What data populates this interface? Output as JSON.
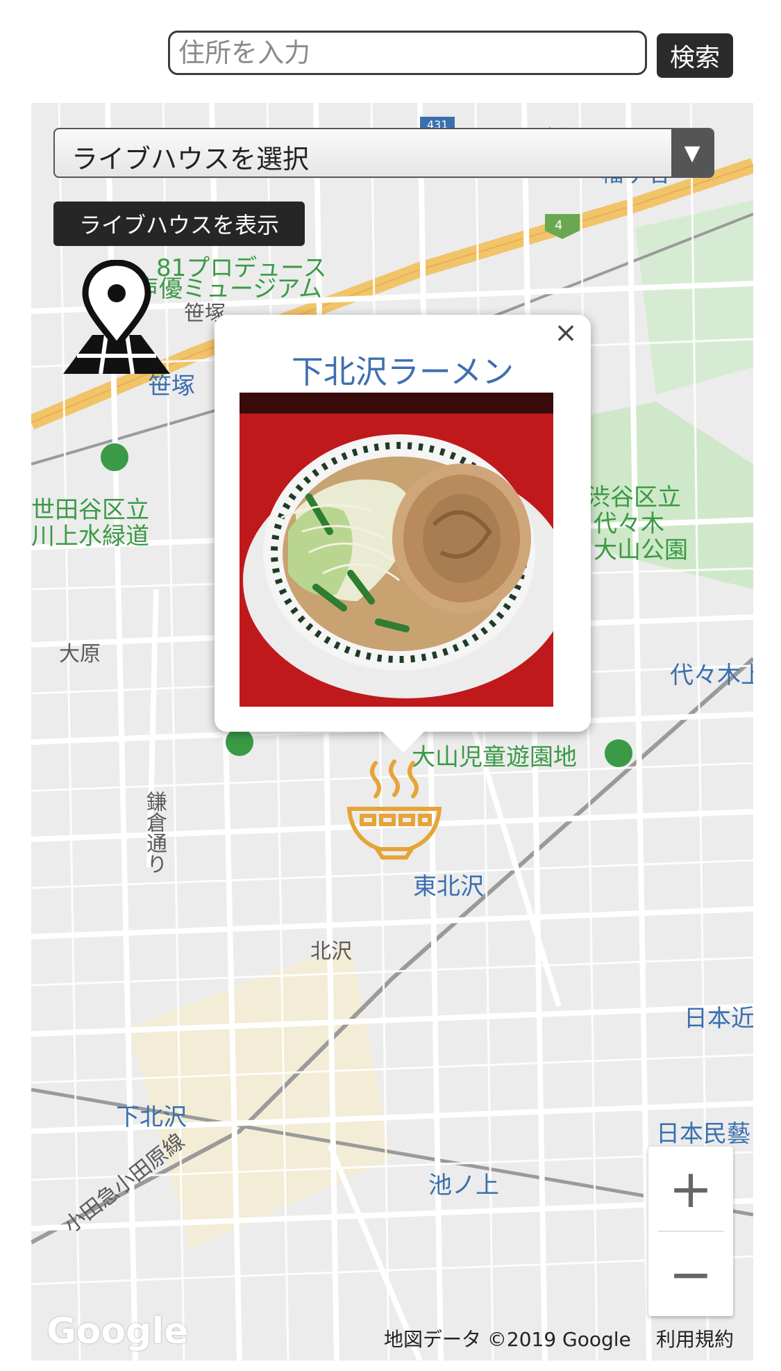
{
  "search": {
    "placeholder": "住所を入力",
    "button_label": "検索"
  },
  "map_controls": {
    "select_label": "ライブハウスを選択",
    "select_arrow": "▼",
    "show_button": "ライブハウスを表示",
    "location_icon": "map-pin-grid-icon"
  },
  "info_window": {
    "title": "下北沢ラーメン",
    "close_label": "×",
    "photo": "ramen-photo-image"
  },
  "marker": {
    "icon": "ramen-bowl-icon",
    "color": "#e6a437"
  },
  "map_labels": [
    {
      "text": "81プロデュース",
      "kind": "green"
    },
    {
      "text": "声優ミュージアム",
      "kind": "green"
    },
    {
      "text": "笹塚",
      "kind": "gray"
    },
    {
      "text": "笹塚",
      "kind": "blue"
    },
    {
      "text": "幡ヶ谷",
      "kind": "blue"
    },
    {
      "text": "幡ヶ谷",
      "kind": "gray"
    },
    {
      "text": "世田谷区立",
      "kind": "green"
    },
    {
      "text": "川上水緑道",
      "kind": "green"
    },
    {
      "text": "渋谷区立",
      "kind": "green"
    },
    {
      "text": "代々木",
      "kind": "green"
    },
    {
      "text": "大山公園",
      "kind": "green"
    },
    {
      "text": "大原",
      "kind": "gray"
    },
    {
      "text": "代々木上",
      "kind": "blue"
    },
    {
      "text": "大山児童遊園地",
      "kind": "green"
    },
    {
      "text": "鎌倉通り",
      "kind": "gray"
    },
    {
      "text": "東北沢",
      "kind": "blue"
    },
    {
      "text": "北沢",
      "kind": "gray"
    },
    {
      "text": "日本近",
      "kind": "blue"
    },
    {
      "text": "下北沢",
      "kind": "blue"
    },
    {
      "text": "日本民藝",
      "kind": "blue"
    },
    {
      "text": "池ノ上",
      "kind": "blue"
    },
    {
      "text": "小田急小田原線",
      "kind": "gray"
    },
    {
      "text": "4",
      "kind": "route"
    },
    {
      "text": "431",
      "kind": "route"
    }
  ],
  "zoom": {
    "in": "+",
    "out": "−"
  },
  "footer": {
    "logo": "Google",
    "attribution": "地図データ ©2019 Google",
    "terms": "利用規約"
  }
}
